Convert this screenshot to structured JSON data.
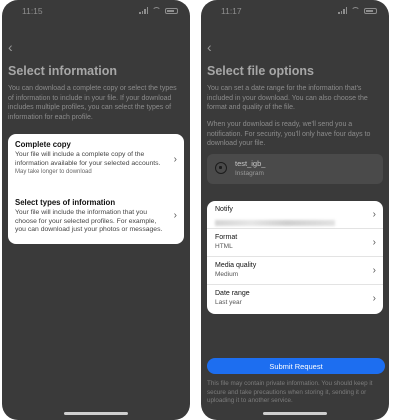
{
  "left": {
    "status_time": "11:15",
    "title": "Select information",
    "description": "You can download a complete copy or select the types of information to include in your file. If your download includes multiple profiles, you can select the types of information for each profile.",
    "options": [
      {
        "title": "Complete copy",
        "desc": "Your file will include a complete copy of the information available for your selected accounts.",
        "note": "May take longer to download"
      },
      {
        "title": "Select types of information",
        "desc": "Your file will include the information that you choose for your selected profiles. For example, you can download just your photos or messages.",
        "note": ""
      }
    ]
  },
  "right": {
    "status_time": "11:17",
    "title": "Select file options",
    "description": "You can set a date range for the information that's included in your download. You can also choose the format and quality of the file.",
    "description2": "When your download is ready, we'll send you a notification. For security, you'll only have four days to download your file.",
    "profile": {
      "name": "test_igb_",
      "platform": "Instagram"
    },
    "settings": [
      {
        "label": "Notify",
        "value": ""
      },
      {
        "label": "Format",
        "value": "HTML"
      },
      {
        "label": "Media quality",
        "value": "Medium"
      },
      {
        "label": "Date range",
        "value": "Last year"
      }
    ],
    "submit_label": "Submit Request",
    "footer_note": "This file may contain private information. You should keep it secure and take precautions when storing it, sending it or uploading it to another service."
  },
  "colors": {
    "accent": "#1d6ef0",
    "background": "#3a3a3a",
    "card": "#ffffff"
  },
  "icons": {
    "back": "chevron-left-icon",
    "row": "chevron-right-icon",
    "profile": "instagram-icon"
  }
}
